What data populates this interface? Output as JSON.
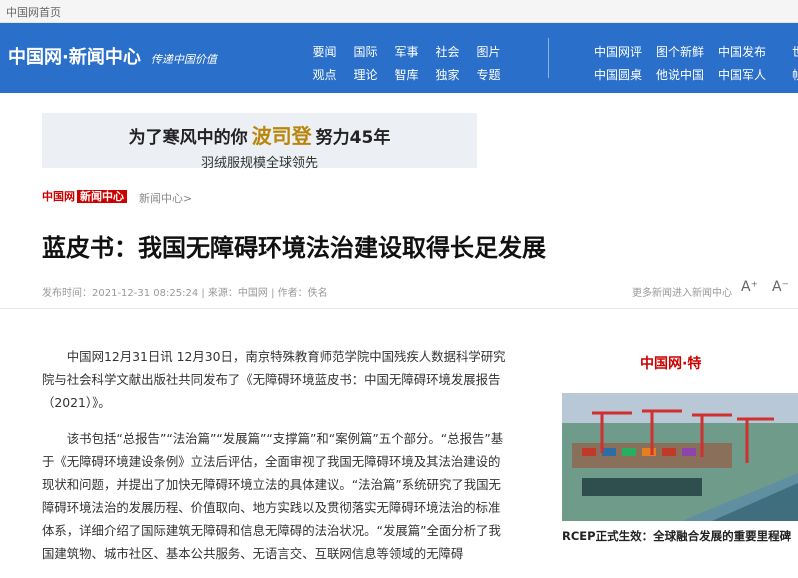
{
  "topbar": {
    "home_link": "中国网首页"
  },
  "header": {
    "logo_text": "中国网·新闻中心",
    "slogan": "传递中国价值",
    "nav_left": [
      "要闻",
      "国际",
      "军事",
      "社会",
      "图片",
      "观点",
      "理论",
      "智库",
      "独家",
      "专题"
    ],
    "nav_right": [
      "中国网评",
      "图个新鲜",
      "中国发布",
      "世相",
      "中国圆桌",
      "他说中国",
      "中国军人",
      "帧像"
    ]
  },
  "ad": {
    "line1_pre": "为了寒风中的你",
    "brand": "波司登",
    "line1_post": "努力45年",
    "line2": "羽绒服规模全球领先"
  },
  "breadcrumb": {
    "logo": "中国网",
    "badge": "新闻中心",
    "path": "新闻中心>"
  },
  "article": {
    "title": "蓝皮书：我国无障碍环境法治建设取得长足发展",
    "meta": "发布时间：2021-12-31 08:25:24 | 来源：中国网 | 作者：佚名",
    "more_link": "更多新闻进入新闻中心",
    "font_up": "A⁺",
    "font_down": "A⁻",
    "paragraphs": [
      "中国网12月31日讯 12月30日，南京特殊教育师范学院中国残疾人数据科学研究院与社会科学文献出版社共同发布了《无障碍环境蓝皮书：中国无障碍环境发展报告（2021）》。",
      "该书包括“总报告”“法治篇”“发展篇”“支撑篇”和“案例篇”五个部分。“总报告”基于《无障碍环境建设条例》立法后评估，全面审视了我国无障碍环境及其法治建设的现状和问题，并提出了加快无障碍环境立法的具体建议。“法治篇”系统研究了我国无障碍环境法治的发展历程、价值取向、地方实践以及贯彻落实无障碍环境法治的标准体系，详细介绍了国际建筑无障碍和信息无障碍的法治状况。“发展篇”全面分析了我国建筑物、城市社区、基本公共服务、无语言交、互联网信息等领域的无障碍"
    ]
  },
  "sidebar": {
    "logo": "中国网·特",
    "caption": "RCEP正式生效：全球融合发展的重要里程碑"
  },
  "colors": {
    "header_blue": "#2a6fc9",
    "brand_red": "#cc0000"
  }
}
